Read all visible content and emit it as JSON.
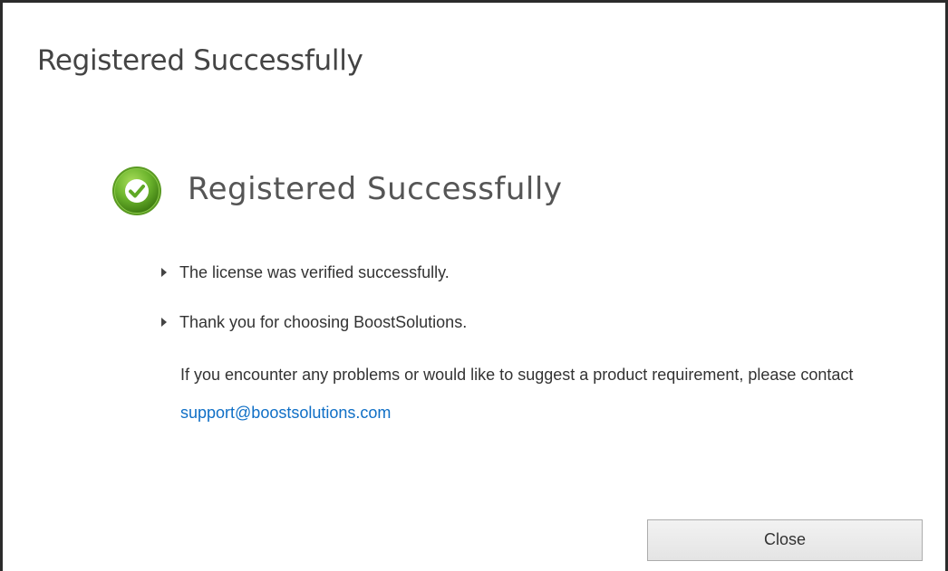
{
  "dialog": {
    "title": "Registered Successfully"
  },
  "content": {
    "heading": "Registered Successfully",
    "status_icon": "green-check-circle-icon",
    "bullets": [
      "The license was verified successfully.",
      "Thank you for choosing BoostSolutions."
    ],
    "note_text": "If you encounter any problems or would like to suggest a product requirement, please contact",
    "support_email": "support@boostsolutions.com"
  },
  "footer": {
    "close_label": "Close"
  },
  "colors": {
    "link": "#0f6fc6",
    "success_green": "#6cb52d"
  }
}
